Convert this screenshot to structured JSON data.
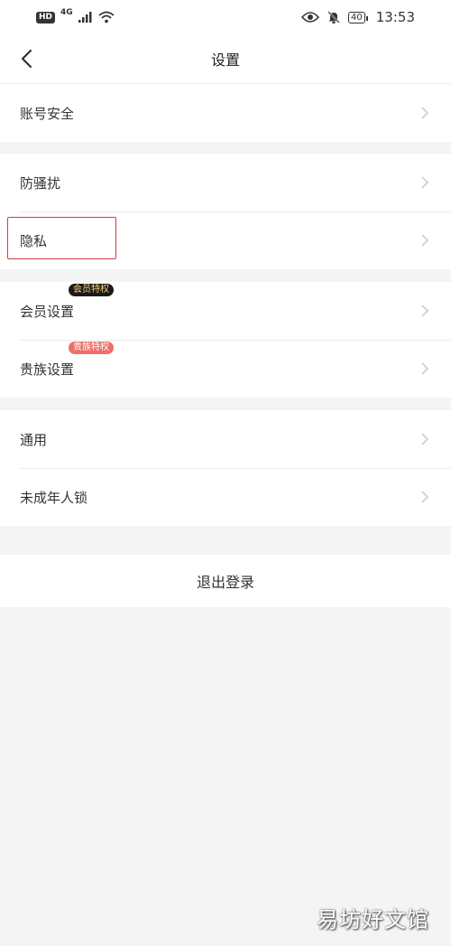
{
  "status": {
    "network": "4G",
    "hd": "HD",
    "battery": "40",
    "time": "13:53"
  },
  "header": {
    "title": "设置"
  },
  "groups": {
    "g1": [
      {
        "label": "账号安全"
      }
    ],
    "g2": [
      {
        "label": "防骚扰"
      },
      {
        "label": "隐私"
      }
    ],
    "g3": [
      {
        "label": "会员设置",
        "badge": "会员特权"
      },
      {
        "label": "贵族设置",
        "badge": "贵族特权"
      }
    ],
    "g4": [
      {
        "label": "通用"
      },
      {
        "label": "未成年人锁"
      }
    ]
  },
  "logout": {
    "label": "退出登录"
  },
  "watermark": "易坊好文馆"
}
